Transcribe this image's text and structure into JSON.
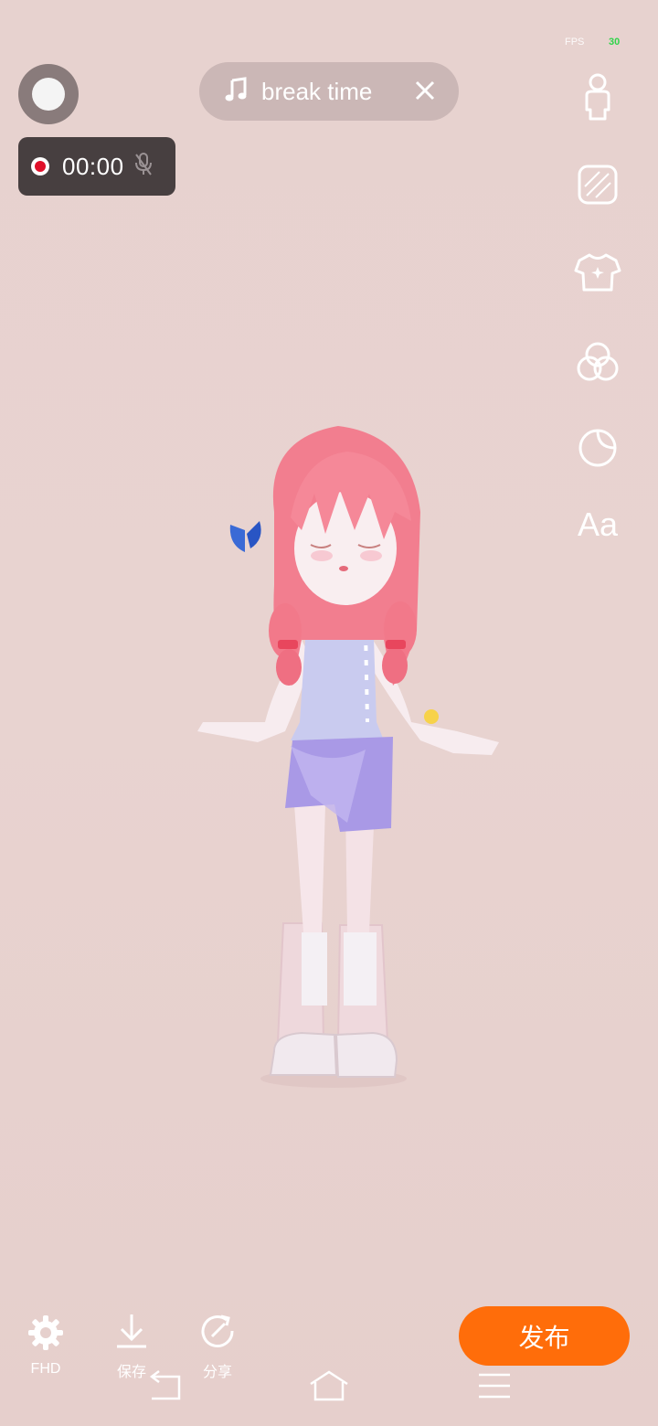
{
  "status": {
    "fps_label": "FPS",
    "fps_value": "30"
  },
  "recording": {
    "time": "00:00"
  },
  "music": {
    "title": "break time"
  },
  "side_tools": [
    {
      "icon": "avatar-body-icon"
    },
    {
      "icon": "background-pattern-icon"
    },
    {
      "icon": "outfit-shirt-icon"
    },
    {
      "icon": "filter-circles-icon"
    },
    {
      "icon": "sticker-icon"
    },
    {
      "icon": "text-icon",
      "label": "Aa"
    }
  ],
  "bottom_bar": {
    "settings_label": "FHD",
    "save_label": "保存",
    "share_label": "分享",
    "publish_label": "发布"
  },
  "colors": {
    "accent": "#ff6d0a",
    "record_dot": "#e0102a",
    "fps_green": "#30d44a"
  }
}
